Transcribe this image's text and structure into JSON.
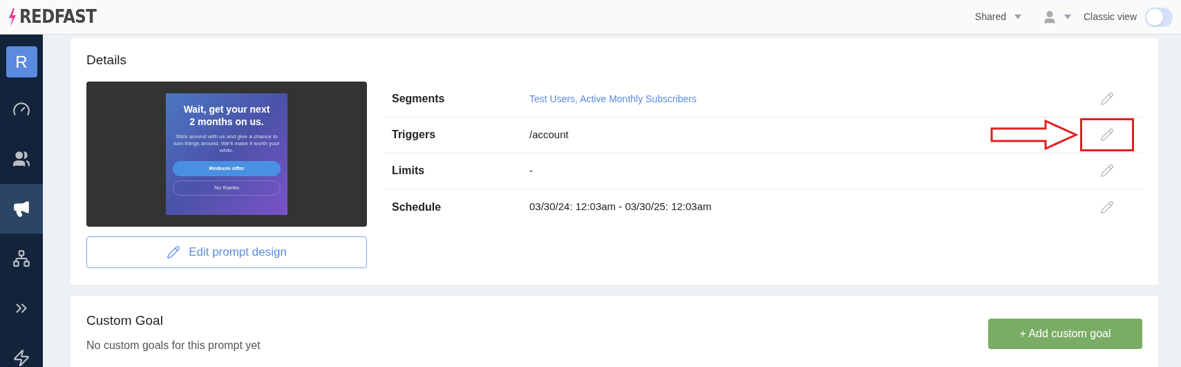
{
  "header": {
    "logo": "REDFAST",
    "shared_menu": "Shared",
    "classic_view": {
      "label": "Classic view",
      "on": false
    }
  },
  "sidebar": {
    "avatar": "R",
    "items": [
      {
        "selected": false
      },
      {
        "selected": false
      },
      {
        "selected": true
      },
      {
        "selected": false
      },
      {
        "selected": false
      },
      {
        "selected": false
      }
    ]
  },
  "details": {
    "title": "Details",
    "preview": {
      "headline": "Wait, get your next 2 months on us.",
      "body": "Stick around with us and give a chance to turn things around. We'll make it worth your while.",
      "primary_button": "Redeem offer",
      "secondary_button": "No thanks"
    },
    "edit_button": "Edit prompt design",
    "rows": [
      {
        "label": "Segments",
        "value": "Test Users, Active Monthly Subscribers",
        "kind": "link",
        "highlighted": false
      },
      {
        "label": "Triggers",
        "value": "/account",
        "kind": "text",
        "highlighted": true
      },
      {
        "label": "Limits",
        "value": "-",
        "kind": "text",
        "highlighted": false
      },
      {
        "label": "Schedule",
        "value": "03/30/24: 12:03am - 03/30/25: 12:03am",
        "kind": "text",
        "highlighted": false
      }
    ]
  },
  "custom_goal": {
    "title": "Custom Goal",
    "subtitle": "No custom goals for this prompt yet",
    "add_button": "+ Add custom goal"
  }
}
